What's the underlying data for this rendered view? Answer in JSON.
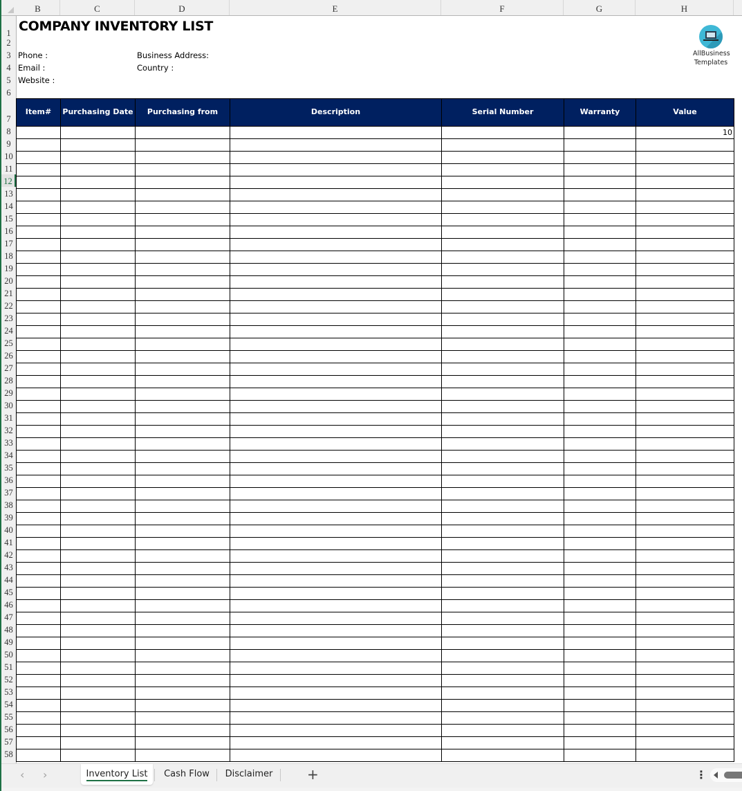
{
  "sheet": {
    "column_headers": [
      "B",
      "C",
      "D",
      "E",
      "F",
      "G",
      "H"
    ],
    "row_numbers_top": [
      "1",
      "2",
      "3",
      "4",
      "5",
      "6",
      "7"
    ],
    "selected_row": "12",
    "title": "COMPANY INVENTORY LIST",
    "info": {
      "phone_label": "Phone :",
      "email_label": "Email :",
      "website_label": "Website :",
      "business_address_label": "Business Address:",
      "country_label": "Country :"
    },
    "logo": {
      "icon": "laptop-icon",
      "line1": "AllBusiness",
      "line2": "Templates",
      "color": "#3fb8d6"
    }
  },
  "table": {
    "header_color": "#002060",
    "columns": [
      "Item#",
      "Purchasing Date",
      "Purchasing from",
      "Description",
      "Serial Number",
      "Warranty",
      "Value"
    ],
    "first_row_number": 8,
    "last_row_number": 58,
    "rows": [
      [
        "",
        "",
        "",
        "",
        "",
        "",
        "10"
      ]
    ]
  },
  "tabs": {
    "prev_icon": "chevron-left-icon",
    "next_icon": "chevron-right-icon",
    "items": [
      {
        "label": "Inventory List",
        "active": true
      },
      {
        "label": "Cash Flow",
        "active": false
      },
      {
        "label": "Disclaimer",
        "active": false
      }
    ],
    "add_label": "+",
    "more_label": "⋮"
  }
}
